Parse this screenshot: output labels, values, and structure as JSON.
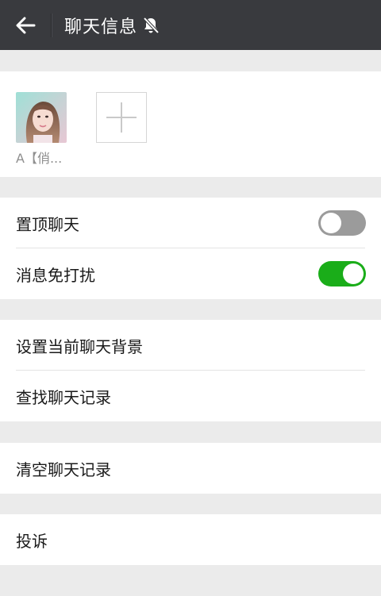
{
  "header": {
    "title": "聊天信息",
    "back_icon": "arrow-left-icon",
    "mute_icon": "bell-off-icon",
    "background": "#393a3e"
  },
  "members": {
    "items": [
      {
        "name": "A【俏...",
        "avatar": "avatar-photo"
      }
    ],
    "add_icon": "plus-icon"
  },
  "settings": {
    "pin_chat": {
      "label": "置顶聊天",
      "enabled": false
    },
    "do_not_disturb": {
      "label": "消息免打扰",
      "enabled": true
    },
    "set_background": {
      "label": "设置当前聊天背景"
    },
    "search_history": {
      "label": "查找聊天记录"
    },
    "clear_history": {
      "label": "清空聊天记录"
    },
    "report": {
      "label": "投诉"
    }
  },
  "colors": {
    "toggle_on": "#1aad19",
    "toggle_off": "#9b9b9b",
    "page_background": "#ebebeb"
  }
}
